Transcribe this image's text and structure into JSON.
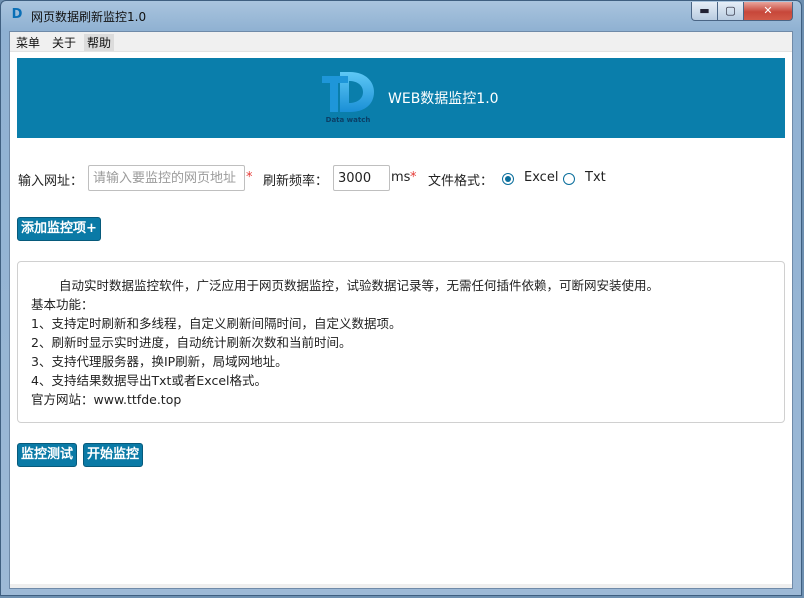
{
  "window": {
    "title": "网页数据刷新监控1.0",
    "icon": "D",
    "min": "▬",
    "max": "▢",
    "close": "✕"
  },
  "menubar": {
    "items": [
      "菜单",
      "关于",
      "帮助"
    ]
  },
  "banner": {
    "title": "WEB数据监控1.0",
    "logo_text": "Data watch",
    "color": "#0a7eab"
  },
  "form": {
    "url_label": "输入网址：",
    "url_placeholder": "请输入要监控的网页地址",
    "url_value": "",
    "required_mark": "*",
    "freq_label": "刷新频率：",
    "freq_value": "3000",
    "freq_unit": "ms",
    "format_label": "文件格式：",
    "format_options": [
      "Excel",
      "Txt"
    ],
    "format_selected": "Excel"
  },
  "buttons": {
    "add": "添加监控项+",
    "test": "监控测试",
    "start": "开始监控"
  },
  "description": {
    "lines": [
      "自动实时数据监控软件，广泛应用于网页数据监控，试验数据记录等，无需任何插件依赖，可断网安装使用。",
      "基本功能：",
      "1、支持定时刷新和多线程，自定义刷新间隔时间，自定义数据项。",
      "2、刷新时显示实时进度，自动统计刷新次数和当前时间。",
      "3、支持代理服务器，换IP刷新，局域网地址。",
      "4、支持结果数据导出Txt或者Excel格式。",
      "官方网站：www.ttfde.top"
    ]
  }
}
